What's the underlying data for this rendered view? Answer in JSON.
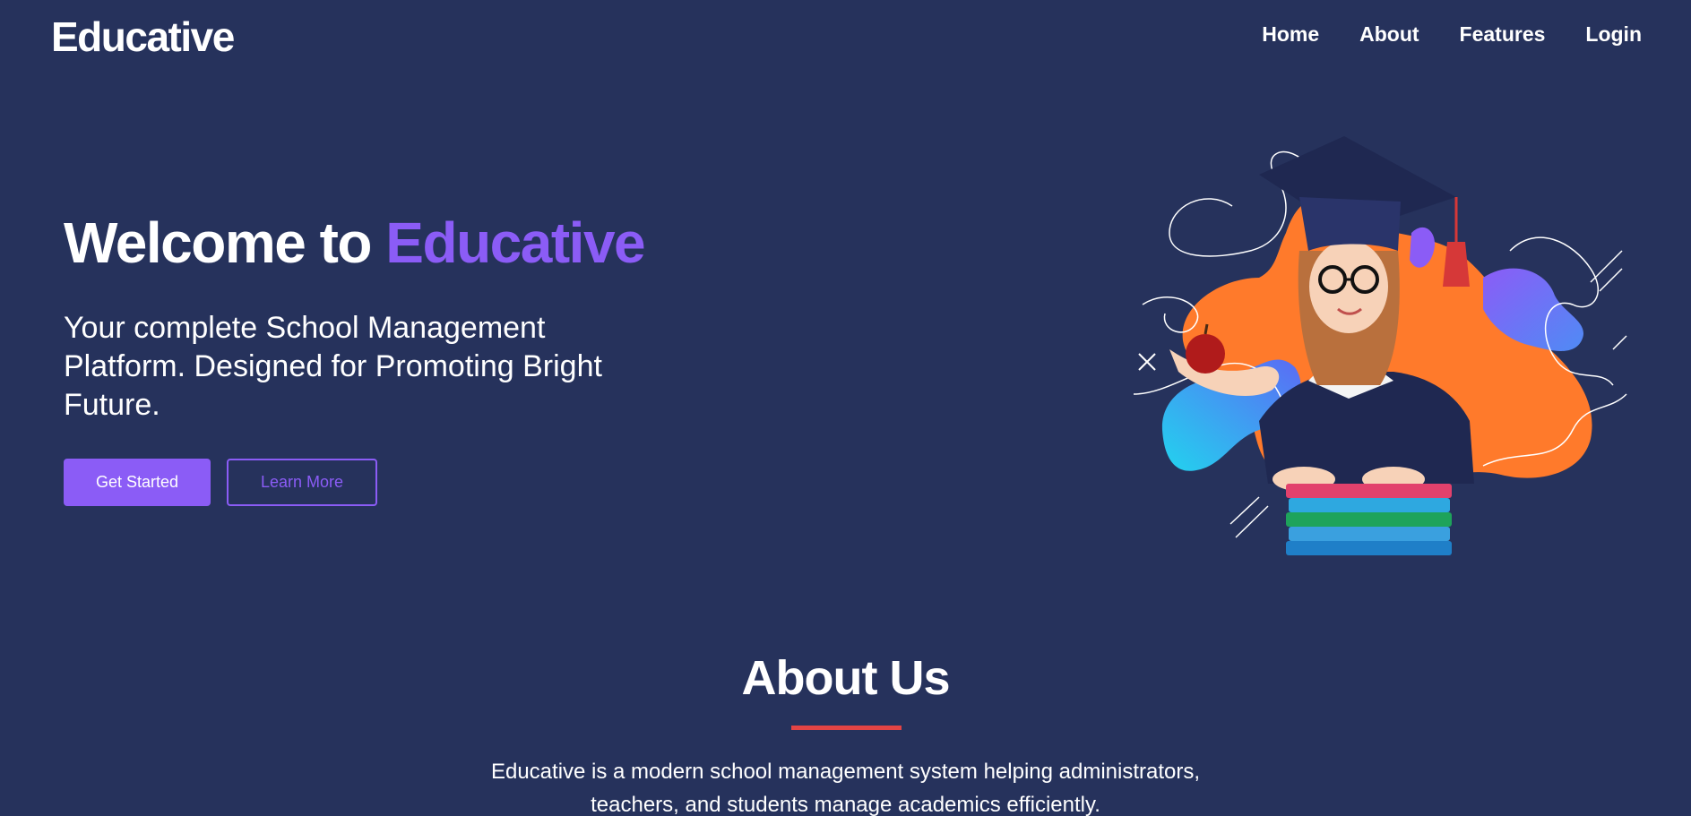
{
  "navbar": {
    "brand": "Educative",
    "links": [
      {
        "label": "Home"
      },
      {
        "label": "About"
      },
      {
        "label": "Features"
      },
      {
        "label": "Login"
      }
    ]
  },
  "hero": {
    "title_prefix": "Welcome to ",
    "title_accent": "Educative",
    "subtitle": "Your complete School Management Platform. Designed for Promoting Bright Future.",
    "primary_button": "Get Started",
    "secondary_button": "Learn More",
    "illustration_icon": "graduate-girl-illustration"
  },
  "about": {
    "title": "About Us",
    "text": "Educative is a modern school management system helping administrators, teachers, and students manage academics efficiently."
  },
  "colors": {
    "background": "#26325c",
    "accent": "#8b5cf6",
    "underline": "#e34444",
    "blob_orange": "#ff7a2b",
    "blob_blue": "#4f8bf5"
  }
}
